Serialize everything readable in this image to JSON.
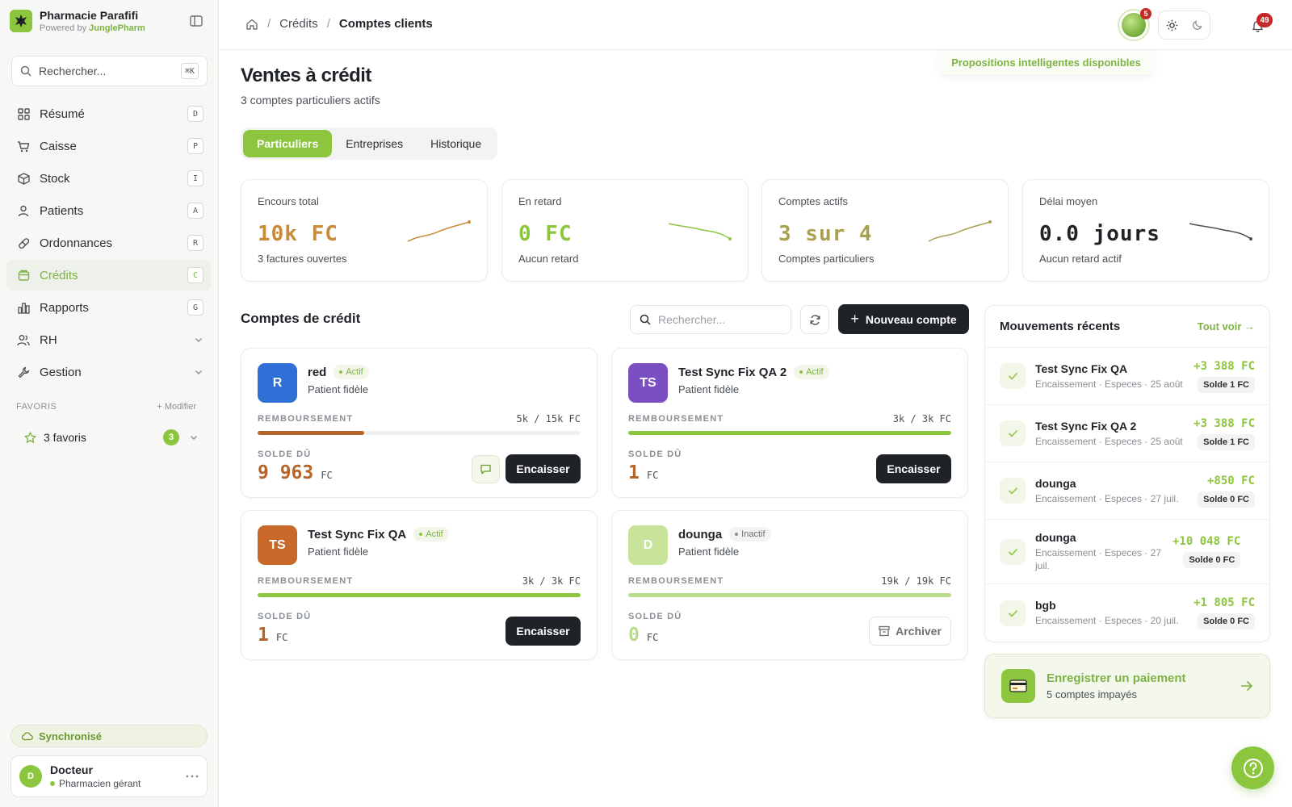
{
  "brand": {
    "name": "Pharmacie Parafifi",
    "powered_prefix": "Powered by",
    "powered_by": "JunglePharm"
  },
  "sidebar": {
    "search_placeholder": "Rechercher...",
    "search_shortcut": "⌘K",
    "items": [
      {
        "label": "Résumé",
        "key": "D",
        "icon": "dashboard-icon"
      },
      {
        "label": "Caisse",
        "key": "P",
        "icon": "cart-icon"
      },
      {
        "label": "Stock",
        "key": "I",
        "icon": "box-icon"
      },
      {
        "label": "Patients",
        "key": "A",
        "icon": "user-icon"
      },
      {
        "label": "Ordonnances",
        "key": "R",
        "icon": "pill-icon"
      },
      {
        "label": "Crédits",
        "key": "C",
        "icon": "credit-icon",
        "active": true
      },
      {
        "label": "Rapports",
        "key": "G",
        "icon": "bar-chart-icon"
      },
      {
        "label": "RH",
        "icon": "team-icon"
      },
      {
        "label": "Gestion",
        "icon": "wrench-icon"
      }
    ],
    "favorites_title": "FAVORIS",
    "favorites_edit": "+ Modifier",
    "favorites_label": "3 favoris",
    "favorites_count": "3",
    "sync_label": "Synchronisé",
    "user": {
      "initial": "D",
      "name": "Docteur",
      "role": "Pharmacien gérant"
    }
  },
  "topbar": {
    "breadcrumb": [
      "Crédits",
      "Comptes clients"
    ],
    "assistant_badge": "5",
    "notifications_count": "49",
    "hint": "Propositions intelligentes disponibles"
  },
  "page": {
    "title": "Ventes à crédit",
    "subtitle": "3 comptes particuliers actifs",
    "tabs": [
      "Particuliers",
      "Entreprises",
      "Historique"
    ],
    "active_tab": 0
  },
  "stats": [
    {
      "label": "Encours total",
      "value": "10k FC",
      "foot": "3 factures ouvertes",
      "trend": "up",
      "color": "#c98a3a"
    },
    {
      "label": "En retard",
      "value": "0 FC",
      "foot": "Aucun retard",
      "trend": "down",
      "color": "#8cc63f"
    },
    {
      "label": "Comptes actifs",
      "value": "3 sur 4",
      "foot": "Comptes particuliers",
      "trend": "up",
      "color": "#a9a050"
    },
    {
      "label": "Délai moyen",
      "value": "0.0 jours",
      "foot": "Aucun retard actif",
      "trend": "down",
      "color": "#1f2328"
    }
  ],
  "credits": {
    "title": "Comptes de crédit",
    "search_placeholder": "Rechercher...",
    "new_label": "Nouveau compte",
    "reimb_caption": "REMBOURSEMENT",
    "due_caption": "SOLDE DÛ",
    "pay_label": "Encaisser",
    "archive_label": "Archiver",
    "accounts": [
      {
        "initials": "R",
        "name": "red",
        "status": "Actif",
        "type": "Patient fidèle",
        "reimb": "5k / 15k FC",
        "progress": 0.33,
        "due": "9 963",
        "unit": "FC",
        "avatar": "#2f6fd6",
        "bar": "#b5652a",
        "due_color": "#b5652a"
      },
      {
        "initials": "TS",
        "name": "Test Sync Fix QA 2",
        "status": "Actif",
        "type": "Patient fidèle",
        "reimb": "3k / 3k FC",
        "progress": 1.0,
        "due": "1",
        "unit": "FC",
        "avatar": "#7a4fc4",
        "bar": "#8cc63f",
        "due_color": "#b5652a"
      },
      {
        "initials": "TS",
        "name": "Test Sync Fix QA",
        "status": "Actif",
        "type": "Patient fidèle",
        "reimb": "3k / 3k FC",
        "progress": 1.0,
        "due": "1",
        "unit": "FC",
        "avatar": "#c8692a",
        "bar": "#8cc63f",
        "due_color": "#b5652a"
      },
      {
        "initials": "D",
        "name": "dounga",
        "status": "Inactif",
        "type": "Patient fidèle",
        "reimb": "19k / 19k FC",
        "progress": 1.0,
        "due": "0",
        "unit": "FC",
        "avatar": "#c8e39a",
        "bar": "#b8dc8a",
        "due_color": "#b8dc8a"
      }
    ]
  },
  "movements": {
    "title": "Mouvements récents",
    "see_all": "Tout voir →",
    "items": [
      {
        "name": "Test Sync Fix QA",
        "desc": "Encaissement · Especes · 25 août",
        "amount": "+3 388 FC",
        "balance": "Solde 1 FC"
      },
      {
        "name": "Test Sync Fix QA 2",
        "desc": "Encaissement · Especes · 25 août",
        "amount": "+3 388 FC",
        "balance": "Solde 1 FC"
      },
      {
        "name": "dounga",
        "desc": "Encaissement · Especes · 27 juil.",
        "amount": "+850 FC",
        "balance": "Solde 0 FC"
      },
      {
        "name": "dounga",
        "desc": "Encaissement · Especes · 27 juil.",
        "amount": "+10 048 FC",
        "balance": "Solde 0 FC"
      },
      {
        "name": "bgb",
        "desc": "Encaissement · Especes · 20 juil.",
        "amount": "+1 805 FC",
        "balance": "Solde 0 FC"
      }
    ]
  },
  "payment_card": {
    "title": "Enregistrer un paiement",
    "subtitle": "5 comptes impayés"
  },
  "colors": {
    "accent": "#8cc63f",
    "dark": "#1f2328",
    "warning": "#b5652a",
    "danger": "#c62828"
  }
}
